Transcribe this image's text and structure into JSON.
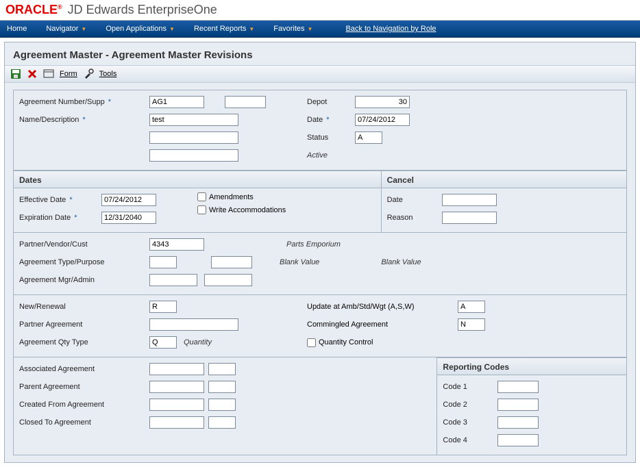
{
  "brand": {
    "logo": "ORACLE",
    "app": "JD Edwards EnterpriseOne"
  },
  "nav": {
    "home": "Home",
    "navigator": "Navigator",
    "open_apps": "Open Applications",
    "recent": "Recent Reports",
    "favorites": "Favorites",
    "back": "Back to Navigation by Role"
  },
  "page": {
    "title": "Agreement Master - Agreement Master Revisions"
  },
  "toolbar": {
    "form": "Form",
    "tools": "Tools"
  },
  "top_left": {
    "agreement_number_label": "Agreement Number/Supp",
    "agreement_number": "AG1",
    "agreement_supp": "",
    "name_label": "Name/Description",
    "name": "test",
    "name2": "",
    "name3": ""
  },
  "top_right": {
    "depot_label": "Depot",
    "depot": "30",
    "date_label": "Date",
    "date": "07/24/2012",
    "status_label": "Status",
    "status": "A",
    "status_desc": "Active"
  },
  "dates": {
    "header": "Dates",
    "effective_label": "Effective Date",
    "effective": "07/24/2012",
    "expiration_label": "Expiration Date",
    "expiration": "12/31/2040",
    "amendments_label": "Amendments",
    "write_accom_label": "Write Accommodations"
  },
  "cancel": {
    "header": "Cancel",
    "date_label": "Date",
    "date": "",
    "reason_label": "Reason",
    "reason": ""
  },
  "partner": {
    "partner_label": "Partner/Vendor/Cust",
    "partner": "4343",
    "partner_name": "Parts Emporium",
    "type_label": "Agreement Type/Purpose",
    "type1": "",
    "type2": "",
    "type1_desc": "Blank Value",
    "type2_desc": "Blank Value",
    "mgr_label": "Agreement Mgr/Admin",
    "mgr1": "",
    "mgr2": ""
  },
  "renewal": {
    "new_label": "New/Renewal",
    "new": "R",
    "partner_agr_label": "Partner Agreement",
    "partner_agr": "",
    "qty_type_label": "Agreement Qty Type",
    "qty_type": "Q",
    "qty_type_desc": "Quantity",
    "update_label": "Update at Amb/Std/Wgt (A,S,W)",
    "update": "A",
    "commingled_label": "Commingled Agreement",
    "commingled": "N",
    "qty_control_label": "Quantity Control"
  },
  "assoc": {
    "associated_label": "Associated Agreement",
    "associated1": "",
    "associated2": "",
    "parent_label": "Parent Agreement",
    "parent1": "",
    "parent2": "",
    "created_label": "Created From Agreement",
    "created1": "",
    "created2": "",
    "closed_label": "Closed To Agreement",
    "closed1": "",
    "closed2": ""
  },
  "reporting": {
    "header": "Reporting Codes",
    "code1_label": "Code 1",
    "code1": "",
    "code2_label": "Code 2",
    "code2": "",
    "code3_label": "Code 3",
    "code3": "",
    "code4_label": "Code 4",
    "code4": ""
  }
}
